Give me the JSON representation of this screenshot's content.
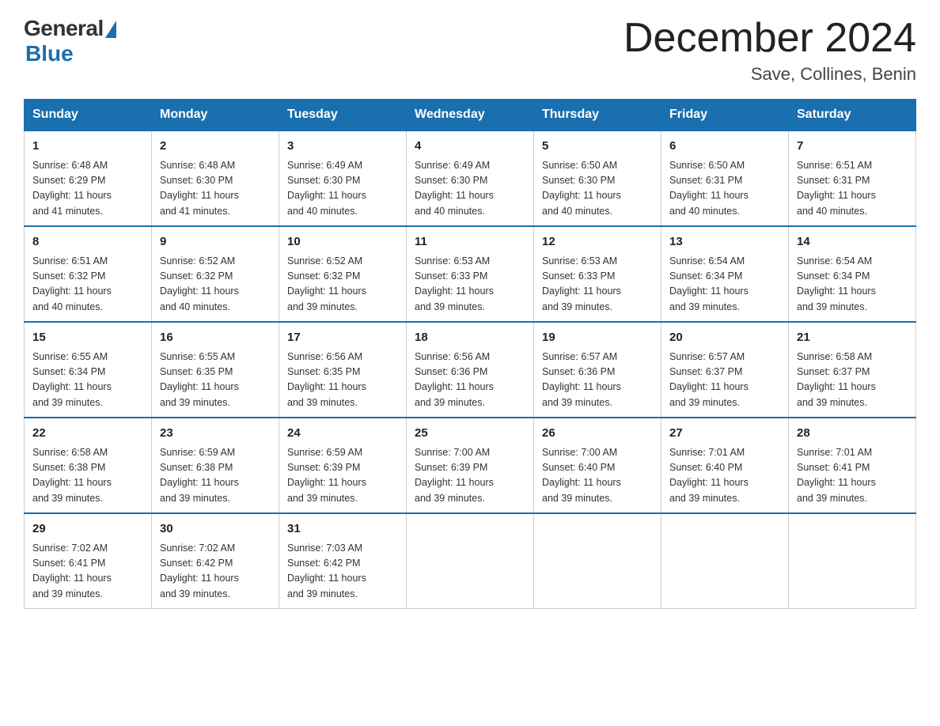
{
  "header": {
    "logo_general": "General",
    "logo_blue": "Blue",
    "month_title": "December 2024",
    "location": "Save, Collines, Benin"
  },
  "days_of_week": [
    "Sunday",
    "Monday",
    "Tuesday",
    "Wednesday",
    "Thursday",
    "Friday",
    "Saturday"
  ],
  "weeks": [
    [
      {
        "day": "1",
        "sunrise": "6:48 AM",
        "sunset": "6:29 PM",
        "daylight": "11 hours and 41 minutes."
      },
      {
        "day": "2",
        "sunrise": "6:48 AM",
        "sunset": "6:30 PM",
        "daylight": "11 hours and 41 minutes."
      },
      {
        "day": "3",
        "sunrise": "6:49 AM",
        "sunset": "6:30 PM",
        "daylight": "11 hours and 40 minutes."
      },
      {
        "day": "4",
        "sunrise": "6:49 AM",
        "sunset": "6:30 PM",
        "daylight": "11 hours and 40 minutes."
      },
      {
        "day": "5",
        "sunrise": "6:50 AM",
        "sunset": "6:30 PM",
        "daylight": "11 hours and 40 minutes."
      },
      {
        "day": "6",
        "sunrise": "6:50 AM",
        "sunset": "6:31 PM",
        "daylight": "11 hours and 40 minutes."
      },
      {
        "day": "7",
        "sunrise": "6:51 AM",
        "sunset": "6:31 PM",
        "daylight": "11 hours and 40 minutes."
      }
    ],
    [
      {
        "day": "8",
        "sunrise": "6:51 AM",
        "sunset": "6:32 PM",
        "daylight": "11 hours and 40 minutes."
      },
      {
        "day": "9",
        "sunrise": "6:52 AM",
        "sunset": "6:32 PM",
        "daylight": "11 hours and 40 minutes."
      },
      {
        "day": "10",
        "sunrise": "6:52 AM",
        "sunset": "6:32 PM",
        "daylight": "11 hours and 39 minutes."
      },
      {
        "day": "11",
        "sunrise": "6:53 AM",
        "sunset": "6:33 PM",
        "daylight": "11 hours and 39 minutes."
      },
      {
        "day": "12",
        "sunrise": "6:53 AM",
        "sunset": "6:33 PM",
        "daylight": "11 hours and 39 minutes."
      },
      {
        "day": "13",
        "sunrise": "6:54 AM",
        "sunset": "6:34 PM",
        "daylight": "11 hours and 39 minutes."
      },
      {
        "day": "14",
        "sunrise": "6:54 AM",
        "sunset": "6:34 PM",
        "daylight": "11 hours and 39 minutes."
      }
    ],
    [
      {
        "day": "15",
        "sunrise": "6:55 AM",
        "sunset": "6:34 PM",
        "daylight": "11 hours and 39 minutes."
      },
      {
        "day": "16",
        "sunrise": "6:55 AM",
        "sunset": "6:35 PM",
        "daylight": "11 hours and 39 minutes."
      },
      {
        "day": "17",
        "sunrise": "6:56 AM",
        "sunset": "6:35 PM",
        "daylight": "11 hours and 39 minutes."
      },
      {
        "day": "18",
        "sunrise": "6:56 AM",
        "sunset": "6:36 PM",
        "daylight": "11 hours and 39 minutes."
      },
      {
        "day": "19",
        "sunrise": "6:57 AM",
        "sunset": "6:36 PM",
        "daylight": "11 hours and 39 minutes."
      },
      {
        "day": "20",
        "sunrise": "6:57 AM",
        "sunset": "6:37 PM",
        "daylight": "11 hours and 39 minutes."
      },
      {
        "day": "21",
        "sunrise": "6:58 AM",
        "sunset": "6:37 PM",
        "daylight": "11 hours and 39 minutes."
      }
    ],
    [
      {
        "day": "22",
        "sunrise": "6:58 AM",
        "sunset": "6:38 PM",
        "daylight": "11 hours and 39 minutes."
      },
      {
        "day": "23",
        "sunrise": "6:59 AM",
        "sunset": "6:38 PM",
        "daylight": "11 hours and 39 minutes."
      },
      {
        "day": "24",
        "sunrise": "6:59 AM",
        "sunset": "6:39 PM",
        "daylight": "11 hours and 39 minutes."
      },
      {
        "day": "25",
        "sunrise": "7:00 AM",
        "sunset": "6:39 PM",
        "daylight": "11 hours and 39 minutes."
      },
      {
        "day": "26",
        "sunrise": "7:00 AM",
        "sunset": "6:40 PM",
        "daylight": "11 hours and 39 minutes."
      },
      {
        "day": "27",
        "sunrise": "7:01 AM",
        "sunset": "6:40 PM",
        "daylight": "11 hours and 39 minutes."
      },
      {
        "day": "28",
        "sunrise": "7:01 AM",
        "sunset": "6:41 PM",
        "daylight": "11 hours and 39 minutes."
      }
    ],
    [
      {
        "day": "29",
        "sunrise": "7:02 AM",
        "sunset": "6:41 PM",
        "daylight": "11 hours and 39 minutes."
      },
      {
        "day": "30",
        "sunrise": "7:02 AM",
        "sunset": "6:42 PM",
        "daylight": "11 hours and 39 minutes."
      },
      {
        "day": "31",
        "sunrise": "7:03 AM",
        "sunset": "6:42 PM",
        "daylight": "11 hours and 39 minutes."
      },
      null,
      null,
      null,
      null
    ]
  ],
  "labels": {
    "sunrise": "Sunrise:",
    "sunset": "Sunset:",
    "daylight": "Daylight:"
  }
}
